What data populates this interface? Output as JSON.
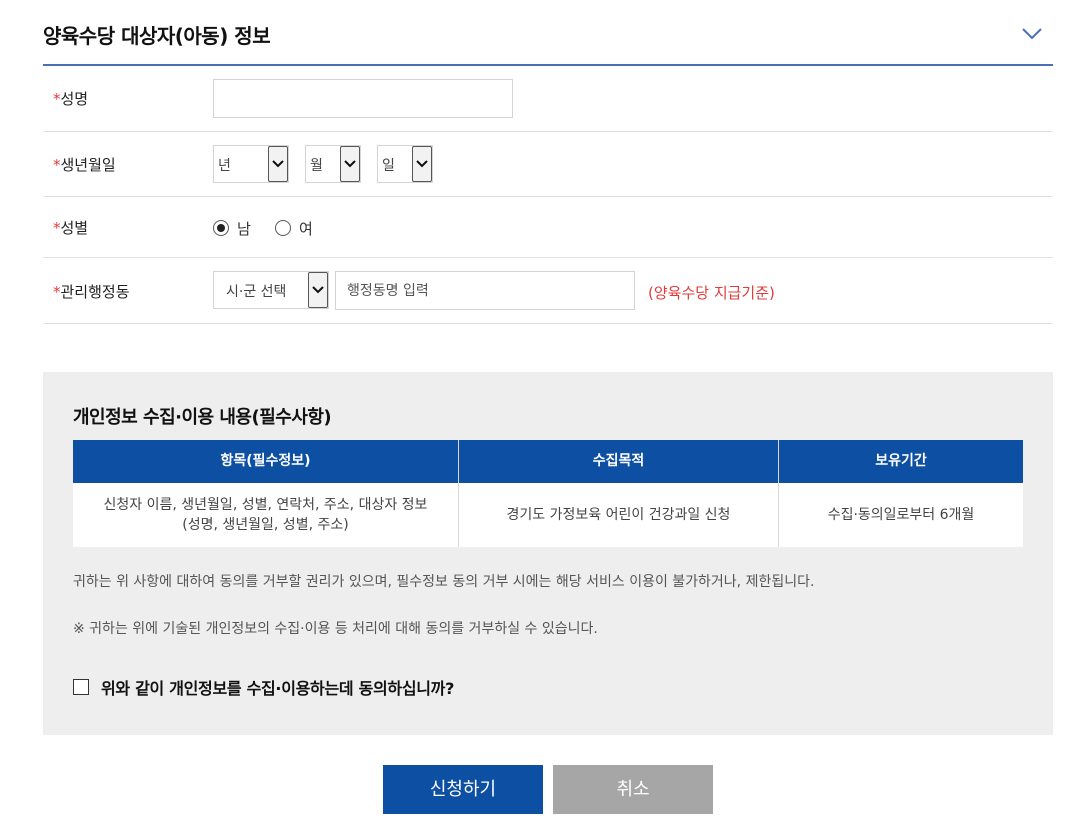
{
  "section": {
    "title": "양육수당 대상자(아동) 정보"
  },
  "form": {
    "required_mark": "*",
    "name": {
      "label": "성명",
      "value": ""
    },
    "birth": {
      "label": "생년월일",
      "year": "년",
      "month": "월",
      "day": "일"
    },
    "gender": {
      "label": "성별",
      "options": [
        "남",
        "여"
      ],
      "selected": "남"
    },
    "district": {
      "label": "관리행정동",
      "city_select": "시·군 선택",
      "dong_placeholder": "행정동명 입력",
      "hint": "(양육수당 지급기준)"
    }
  },
  "privacy": {
    "title": "개인정보 수집·이용 내용(필수사항)",
    "headers": [
      "항목(필수정보)",
      "수집목적",
      "보유기간"
    ],
    "row": [
      "신청자 이름, 생년월일, 성별, 연락처, 주소, 대상자 정보\n(성명, 생년월일, 성별, 주소)",
      "경기도 가정보육 어린이 건강과일 신청",
      "수집·동의일로부터 6개월"
    ],
    "notice1": "귀하는 위 사항에 대하여 동의를 거부할 권리가 있으며, 필수정보 동의 거부 시에는 해당 서비스 이용이 불가하거나, 제한됩니다.",
    "notice2": "※ 귀하는 위에 기술된 개인정보의 수집·이용 등 처리에 대해 동의를 거부하실 수 있습니다.",
    "agree_label": "위와 같이 개인정보를 수집·이용하는데 동의하십니까?",
    "agreed": false
  },
  "buttons": {
    "submit": "신청하기",
    "cancel": "취소"
  },
  "colors": {
    "accent": "#0d4fa3",
    "required": "#e23b3b",
    "header_line": "#4a6fb5",
    "panel_bg": "#eeeeee",
    "cancel_bg": "#a6a6a6"
  },
  "icons": {
    "collapse": "chevron-down-icon",
    "select": "select-arrow-icon"
  }
}
